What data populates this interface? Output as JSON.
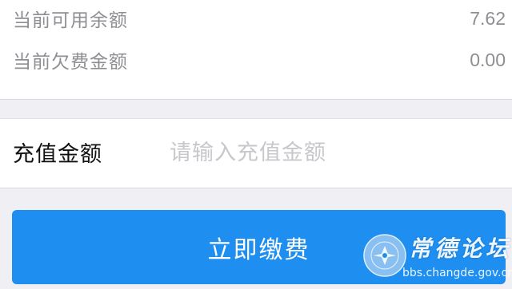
{
  "balance": {
    "available_label": "当前可用余额",
    "available_value": "7.62",
    "owed_label": "当前欠费金额",
    "owed_value": "0.00"
  },
  "recharge": {
    "label": "充值金额",
    "placeholder": "请输入充值金额",
    "value": ""
  },
  "actions": {
    "pay_label": "立即缴费",
    "accent_color": "#1e8ff0"
  },
  "watermark": {
    "title": "常德论坛",
    "url": "bbs.changde.gov.cn"
  }
}
